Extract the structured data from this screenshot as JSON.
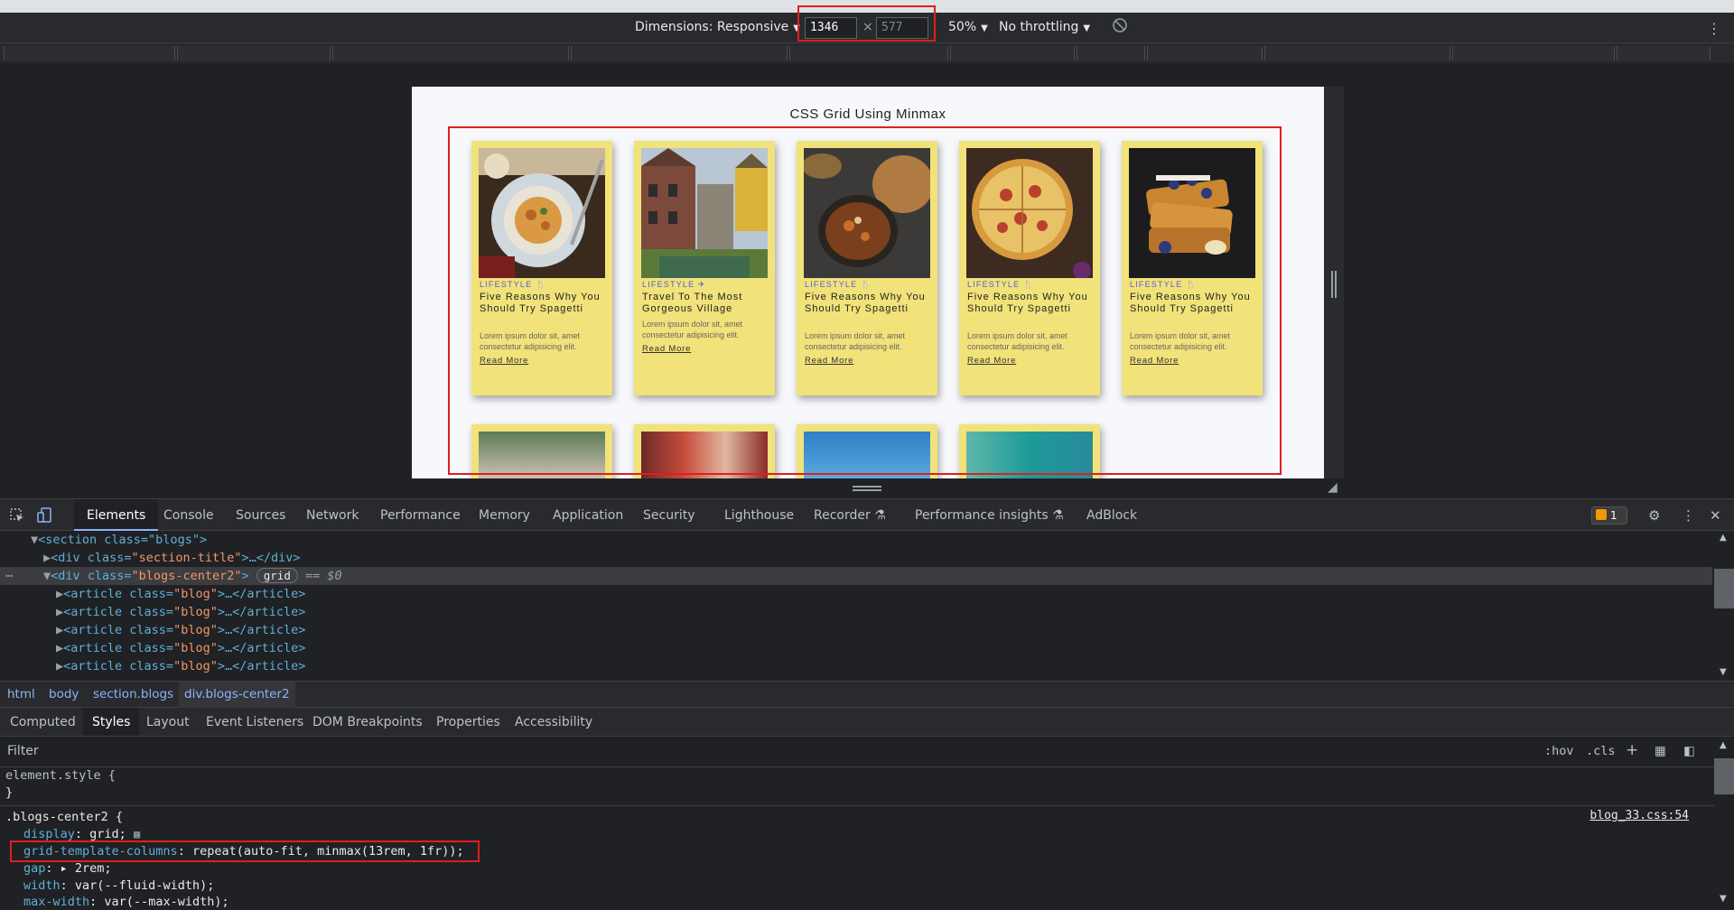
{
  "toolbar": {
    "dimensions_label": "Dimensions: Responsive",
    "width_value": "1346",
    "height_placeholder": "577",
    "times": "×",
    "zoom": "50%",
    "throttling": "No throttling"
  },
  "page": {
    "title": "CSS Grid Using Minmax",
    "cards": [
      {
        "category": "LIFESTYLE",
        "cat_icon": "utensils-icon",
        "title": "Five Reasons Why You Should Try Spagetti",
        "desc": "Lorem ipsum dolor sit, amet consectetur adipisicing elit.",
        "more": "Read More",
        "image": "pasta-plate"
      },
      {
        "category": "LIFESTYLE",
        "cat_icon": "plane-icon",
        "title": "Travel To The Most Gorgeous Village",
        "desc": "Lorem ipsum dolor sit, amet consectetur adipisicing elit.",
        "more": "Read More",
        "image": "village-houses"
      },
      {
        "category": "LIFESTYLE",
        "cat_icon": "utensils-icon",
        "title": "Five Reasons Why You Should Try Spagetti",
        "desc": "Lorem ipsum dolor sit, amet consectetur adipisicing elit.",
        "more": "Read More",
        "image": "stew-bread"
      },
      {
        "category": "LIFESTYLE",
        "cat_icon": "utensils-icon",
        "title": "Five Reasons Why You Should Try Spagetti",
        "desc": "Lorem ipsum dolor sit, amet consectetur adipisicing elit.",
        "more": "Read More",
        "image": "pizza"
      },
      {
        "category": "LIFESTYLE",
        "cat_icon": "utensils-icon",
        "title": "Five Reasons Why You Should Try Spagetti",
        "desc": "Lorem ipsum dolor sit, amet consectetur adipisicing elit.",
        "more": "Read More",
        "image": "french-toast"
      }
    ]
  },
  "devtools": {
    "tabs": [
      "Elements",
      "Console",
      "Sources",
      "Network",
      "Performance",
      "Memory",
      "Application",
      "Security",
      "Lighthouse",
      "Recorder",
      "Performance insights",
      "AdBlock"
    ],
    "warnings_count": "1",
    "dom": {
      "section_line": "<section class=\"blogs\">",
      "title_div": {
        "open": "<div class=",
        "cls": "\"section-title\"",
        "close": ">…</div>"
      },
      "selected": {
        "open": "<div class=",
        "cls": "\"blogs-center2\"",
        "close": ">",
        "badge": "grid",
        "eq": "== $0"
      },
      "article": {
        "open": "<article class=",
        "cls": "\"blog\"",
        "close": ">…</article>"
      }
    },
    "breadcrumbs": [
      "html",
      "body",
      "section.blogs",
      "div.blogs-center2"
    ],
    "style_tabs": [
      "Computed",
      "Styles",
      "Layout",
      "Event Listeners",
      "DOM Breakpoints",
      "Properties",
      "Accessibility"
    ],
    "filter_placeholder": "Filter",
    "filter_tools": {
      "hov": ":hov",
      "cls": ".cls",
      "plus": "+"
    },
    "styles": {
      "element_style_open": "element.style {",
      "close_brace": "}",
      "selector": ".blogs-center2 {",
      "source": "blog_33.css:54",
      "rules": [
        {
          "prop": "display",
          "val": "grid;"
        },
        {
          "prop": "grid-template-columns",
          "val": "repeat(auto-fit, minmax(13rem, 1fr));"
        },
        {
          "prop": "gap",
          "val": "▸ 2rem;"
        },
        {
          "prop": "width",
          "val": "var(--fluid-width);"
        },
        {
          "prop": "max-width",
          "val": "var(--max-width);"
        }
      ]
    }
  }
}
